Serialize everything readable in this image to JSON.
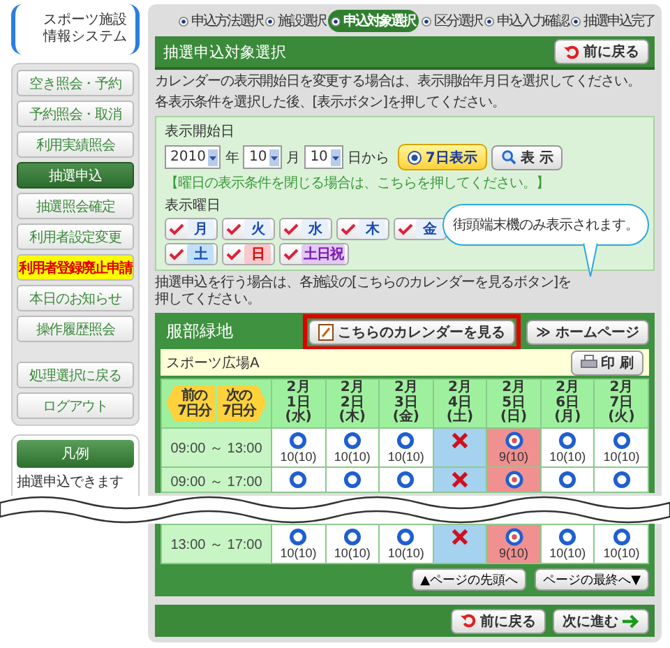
{
  "logo": {
    "lines": [
      "スポーツ施設",
      "情報システム"
    ]
  },
  "nav": {
    "items": [
      {
        "label": "空き照会・予約",
        "selected": false,
        "kind": "normal"
      },
      {
        "label": "予約照会・取消",
        "selected": false,
        "kind": "normal"
      },
      {
        "label": "利用実績照会",
        "selected": false,
        "kind": "normal"
      },
      {
        "label": "抽選申込",
        "selected": true,
        "kind": "normal"
      },
      {
        "label": "抽選照会確定",
        "selected": false,
        "kind": "normal"
      },
      {
        "label": "利用者設定変更",
        "selected": false,
        "kind": "normal"
      },
      {
        "label": "利用者登録廃止申請",
        "selected": false,
        "kind": "warning"
      },
      {
        "label": "本日のお知らせ",
        "selected": false,
        "kind": "normal"
      },
      {
        "label": "操作履歴照会",
        "selected": false,
        "kind": "normal"
      }
    ],
    "secondary": [
      {
        "label": "処理選択に戻る",
        "selected": false
      },
      {
        "label": "ログアウト",
        "selected": false
      }
    ]
  },
  "legend": {
    "title": "凡例",
    "items": [
      "抽選申込できます"
    ]
  },
  "steps": [
    {
      "label": "申込方法選択",
      "selected": false
    },
    {
      "label": "施設選択",
      "selected": false
    },
    {
      "label": "申込対象選択",
      "selected": true
    },
    {
      "label": "区分選択",
      "selected": false
    },
    {
      "label": "申込入力確認",
      "selected": false
    },
    {
      "label": "抽選申込完了",
      "selected": false
    }
  ],
  "page": {
    "title": "抽選申込対象選択",
    "back_button": "前に戻る",
    "description": [
      "カレンダーの表示開始日を変更する場合は、表示開始年月日を選択してください。",
      "各表示条件を選択した後、[表示ボタン]を押してください。"
    ]
  },
  "filter": {
    "start_label": "表示開始日",
    "year": "2010",
    "year_unit": "年",
    "month": "10",
    "month_unit": "月",
    "day": "10",
    "day_unit": "日から",
    "seven_day_button": "7日表示",
    "show_button": "表 示",
    "toggle_note": "【曜日の表示条件を閉じる場合は、こちらを押してください。】",
    "weekday_label": "表示曜日",
    "weekdays": [
      {
        "label": "月",
        "checked": true,
        "kind": "weekday"
      },
      {
        "label": "火",
        "checked": true,
        "kind": "weekday"
      },
      {
        "label": "水",
        "checked": true,
        "kind": "weekday"
      },
      {
        "label": "木",
        "checked": true,
        "kind": "weekday"
      },
      {
        "label": "金",
        "checked": true,
        "kind": "weekday"
      },
      {
        "label": "土",
        "checked": true,
        "kind": "saturday"
      },
      {
        "label": "日",
        "checked": true,
        "kind": "sunday"
      },
      {
        "label": "土日祝",
        "checked": true,
        "kind": "holiday"
      }
    ]
  },
  "tooltip": "街頭端末機のみ表示されます。",
  "instruction": "抽選申込を行う場合は、各施設の[こちらのカレンダーを見るボタン]を押してください。",
  "facility": {
    "name": "服部緑地",
    "calendar_button": "こちらのカレンダーを見る",
    "homepage_button": "≫ ホームページ",
    "venue": "スポーツ広場A",
    "print_button": "印 刷",
    "prev_button": [
      "前の",
      "7日分"
    ],
    "next_button": [
      "次の",
      "7日分"
    ],
    "days": [
      {
        "month": "2月",
        "day": "1日",
        "weekday": "(水)",
        "kind": "weekday"
      },
      {
        "month": "2月",
        "day": "2日",
        "weekday": "(木)",
        "kind": "weekday"
      },
      {
        "month": "2月",
        "day": "3日",
        "weekday": "(金)",
        "kind": "weekday"
      },
      {
        "month": "2月",
        "day": "4日",
        "weekday": "(土)",
        "kind": "saturday"
      },
      {
        "month": "2月",
        "day": "5日",
        "weekday": "(日)",
        "kind": "sunday"
      },
      {
        "month": "2月",
        "day": "6日",
        "weekday": "(月)",
        "kind": "weekday"
      },
      {
        "month": "2月",
        "day": "7日",
        "weekday": "(火)",
        "kind": "weekday"
      }
    ],
    "slots": [
      {
        "time": "09:00 ～ 13:00",
        "cells": [
          {
            "kind": "available",
            "count": "10(10)"
          },
          {
            "kind": "available",
            "count": "10(10)"
          },
          {
            "kind": "available",
            "count": "10(10)"
          },
          {
            "kind": "full"
          },
          {
            "kind": "lottery",
            "count": "9(10)"
          },
          {
            "kind": "available",
            "count": "10(10)"
          },
          {
            "kind": "available",
            "count": "10(10)"
          }
        ]
      },
      {
        "time": "09:00 ～ 17:00",
        "cells": [
          {
            "kind": "available"
          },
          {
            "kind": "available"
          },
          {
            "kind": "available"
          },
          {
            "kind": "full"
          },
          {
            "kind": "lottery"
          },
          {
            "kind": "available"
          },
          {
            "kind": "available"
          }
        ]
      },
      {
        "time": "13:00 ～ 17:00",
        "cells": [
          {
            "kind": "available",
            "count": "10(10)"
          },
          {
            "kind": "available",
            "count": "10(10)"
          },
          {
            "kind": "available",
            "count": "10(10)"
          },
          {
            "kind": "full"
          },
          {
            "kind": "lottery",
            "count": "9(10)"
          },
          {
            "kind": "available",
            "count": "10(10)"
          },
          {
            "kind": "available",
            "count": "10(10)"
          }
        ]
      }
    ],
    "top_button": "▲ページの先頭へ",
    "bottom_button": "ページの最終へ▼"
  },
  "footer": {
    "back_button": "前に戻る",
    "next_button": "次に進む"
  }
}
